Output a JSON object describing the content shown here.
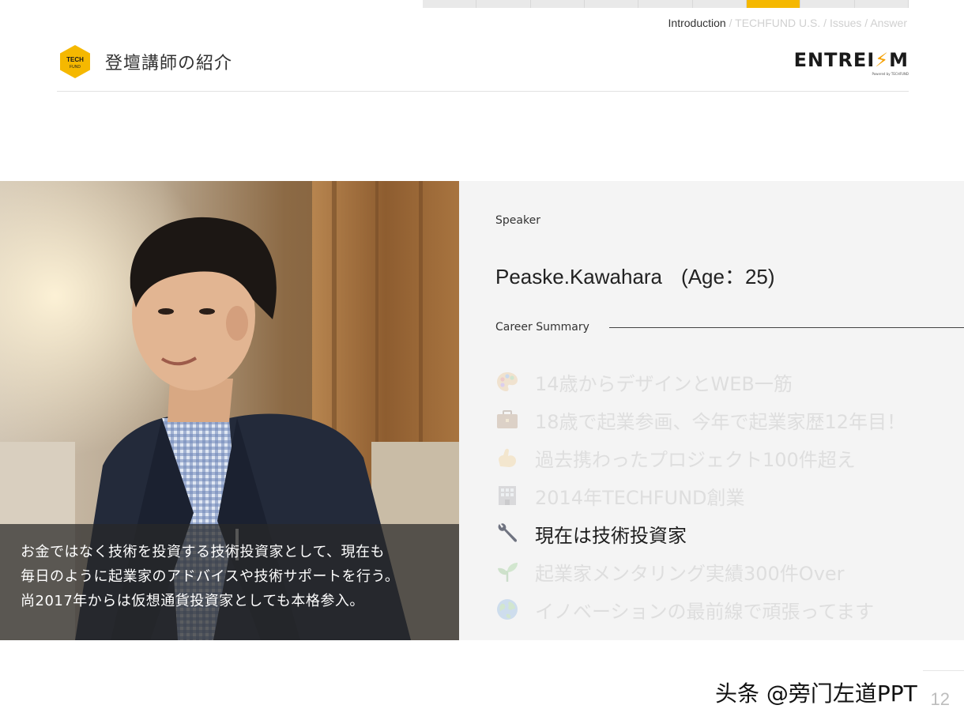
{
  "progress": {
    "segments": 9,
    "active_index": 6
  },
  "breadcrumb": {
    "current": "Introduction",
    "separator": " / ",
    "rest": [
      "TECHFUND U.S.",
      "Issues",
      "Answer"
    ]
  },
  "header": {
    "logo_text_top": "TECH",
    "logo_text_bottom": "FUND",
    "title": "登壇講師の紹介",
    "brand_left": "ENTREI",
    "brand_bolt": "⚡",
    "brand_right": "M",
    "brand_sub": "Powered by TECHFUND"
  },
  "photo": {
    "caption_lines": [
      "お金ではなく技術を投資する技術投資家として、現在も",
      "毎日のように起業家のアドバイスや技術サポートを行う。",
      "尚2017年からは仮想通貨投資家としても本格参入。"
    ]
  },
  "speaker": {
    "label": "Speaker",
    "name": "Peaske.Kawahara",
    "age": "(Age：25)",
    "career_label": "Career Summary",
    "career_items": [
      {
        "icon": "palette-icon",
        "text": "14歳からデザインとWEB一筋",
        "highlight": false
      },
      {
        "icon": "briefcase-icon",
        "text": "18歳で起業参画、今年で起業家歴12年目！",
        "highlight": false
      },
      {
        "icon": "flexed-biceps-icon",
        "text": "過去携わったプロジェクト100件超え",
        "highlight": false
      },
      {
        "icon": "office-building-icon",
        "text": "2014年TECHFUND創業",
        "highlight": false
      },
      {
        "icon": "wrench-icon",
        "text": "現在は技術投資家",
        "highlight": true
      },
      {
        "icon": "seedling-icon",
        "text": "起業家メンタリング実績300件Over",
        "highlight": false
      },
      {
        "icon": "globe-icon",
        "text": "イノベーションの最前線で頑張ってます",
        "highlight": false
      }
    ]
  },
  "footer": {
    "watermark": "头条 @旁门左道PPT",
    "page_number": "12"
  },
  "colors": {
    "accent": "#f5b800",
    "panel_bg": "#f4f4f4",
    "muted_text": "#dedede"
  }
}
